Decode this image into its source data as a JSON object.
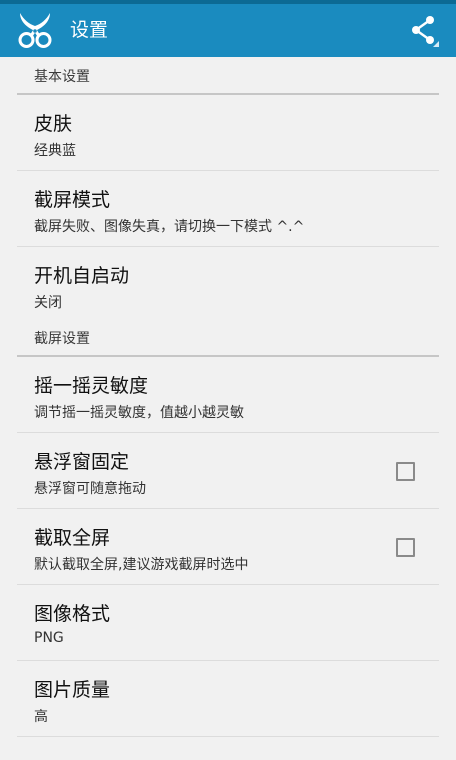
{
  "app": {
    "title": "设置",
    "logo_icon": "scissors-icon",
    "share_icon": "share-icon",
    "colors": {
      "action_bar": "#1a8bbf",
      "status_bar": "#0c6a94",
      "background": "#f1f1f1"
    }
  },
  "sections": {
    "basic": {
      "header": "基本设置",
      "skin": {
        "title": "皮肤",
        "summary": "经典蓝"
      },
      "screenshot_mode": {
        "title": "截屏模式",
        "summary": "截屏失败、图像失真，请切换一下模式 ^.^"
      },
      "autostart": {
        "title": "开机自启动",
        "summary": "关闭"
      }
    },
    "capture": {
      "header": "截屏设置",
      "shake_sensitivity": {
        "title": "摇一摇灵敏度",
        "summary": "调节摇一摇灵敏度，值越小越灵敏"
      },
      "float_fixed": {
        "title": "悬浮窗固定",
        "summary": "悬浮窗可随意拖动",
        "checked": false
      },
      "fullscreen": {
        "title": "截取全屏",
        "summary": "默认截取全屏,建议游戏截屏时选中",
        "checked": false
      },
      "image_format": {
        "title": "图像格式",
        "summary": "PNG"
      },
      "image_quality": {
        "title": "图片质量",
        "summary": "高"
      }
    }
  }
}
